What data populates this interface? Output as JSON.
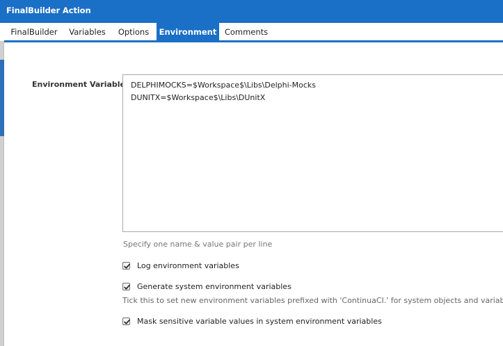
{
  "window": {
    "title": "FinalBuilder Action"
  },
  "tabs": [
    {
      "label": "FinalBuilder"
    },
    {
      "label": "Variables"
    },
    {
      "label": "Options"
    },
    {
      "label": "Environment",
      "active": true
    },
    {
      "label": "Comments"
    }
  ],
  "environment": {
    "field_label": "Environment Variables",
    "lines": [
      "DELPHIMOCKS=$Workspace$\\Libs\\Delphi-Mocks",
      "DUNITX=$Workspace$\\Libs\\DUnitX"
    ],
    "hint": "Specify one name & value pair per line",
    "options": [
      {
        "label": "Log environment variables",
        "checked": true
      },
      {
        "label": "Generate system environment variables",
        "checked": true,
        "description": "Tick this to set new environment variables prefixed with 'ContinuaCI.' for system objects and variables."
      },
      {
        "label": "Mask sensitive variable values in system environment variables",
        "checked": true
      }
    ]
  },
  "colors": {
    "accent": "#1a6fc6"
  }
}
